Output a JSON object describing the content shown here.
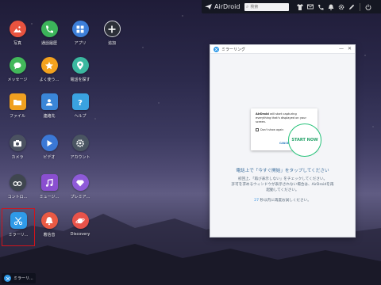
{
  "topbar": {
    "brand": "AirDroid",
    "search_placeholder": "検索"
  },
  "apps": [
    {
      "id": "photos",
      "label": "写真",
      "color": "#e8533f",
      "icon": "image-icon"
    },
    {
      "id": "call-log",
      "label": "通話履歴",
      "color": "#3cb45a",
      "icon": "phone-icon"
    },
    {
      "id": "apps",
      "label": "アプリ",
      "color": "#3d7fd9",
      "icon": "grid-icon"
    },
    {
      "id": "install",
      "label": "追加",
      "color": "#2c2f38",
      "icon": "plus-icon"
    },
    {
      "id": "messages",
      "label": "メッセージ",
      "color": "#42b85a",
      "icon": "chat-icon"
    },
    {
      "id": "frequent",
      "label": "よく使う...",
      "color": "#f4a21e",
      "icon": "star-icon"
    },
    {
      "id": "find-phone",
      "label": "電話を探す",
      "color": "#3bb8a0",
      "icon": "location-icon"
    },
    {
      "id": "files",
      "label": "ファイル",
      "color": "#f0a020",
      "icon": "folder-icon"
    },
    {
      "id": "contacts",
      "label": "連絡先",
      "color": "#3a86d8",
      "icon": "contact-icon"
    },
    {
      "id": "help",
      "label": "ヘルプ",
      "color": "#3aa2e0",
      "icon": "help-icon"
    },
    {
      "id": "camera",
      "label": "カメラ",
      "color": "#4b5261",
      "icon": "camera-icon"
    },
    {
      "id": "video",
      "label": "ビデオ",
      "color": "#3b78d6",
      "icon": "play-icon"
    },
    {
      "id": "account",
      "label": "アカウント",
      "color": "#4a5562",
      "icon": "gear-icon"
    },
    {
      "id": "remote",
      "label": "コントロ...",
      "color": "#3f464f",
      "icon": "binoculars-icon"
    },
    {
      "id": "music",
      "label": "ミュージ...",
      "color": "#8a4fd0",
      "icon": "music-icon"
    },
    {
      "id": "premium",
      "label": "プレミア...",
      "color": "#8e5ad8",
      "icon": "diamond-icon"
    },
    {
      "id": "mirroring",
      "label": "ミラーリ...",
      "color": "#2f9ae8",
      "icon": "scissors-icon",
      "selected": true
    },
    {
      "id": "notifications",
      "label": "着信音",
      "color": "#ea5a44",
      "icon": "bell-icon"
    },
    {
      "id": "discovery",
      "label": "Discovery",
      "color": "#e8534a",
      "icon": "planet-icon"
    }
  ],
  "mirror_window": {
    "title": "ミラーリング",
    "min": "—",
    "close": "✕",
    "dialog": {
      "message_bold": "AirDroid",
      "message": " will start capturing everything that's displayed on your screen.",
      "checkbox_label": "Don't show again",
      "cancel": "CANCEL",
      "start": "START NOW"
    },
    "main_text": "電話上で「今すぐ開始」をタップしてください",
    "sub_line1": "初回上、「再び表示しない」をチェックしてください。",
    "sub_line2": "許可を求めるウィンドウが表示されない場合は、AirDroidを再",
    "sub_line3": "起動してください。",
    "retry_count": "27",
    "retry_text": " 秒以内に再度お試しください。"
  },
  "taskbar": {
    "label": "ミラーリ..."
  }
}
